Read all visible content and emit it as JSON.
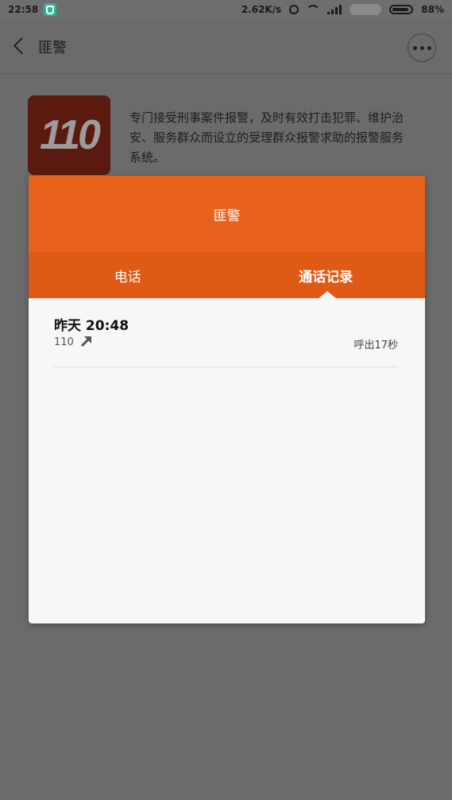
{
  "status_bar": {
    "time": "22:58",
    "network_speed": "2.62K/s",
    "battery": "88%"
  },
  "header": {
    "title": "匪警"
  },
  "info": {
    "logo_text": "110",
    "description": "专门接受刑事案件报警，及时有效打击犯罪、维护治安、服务群众而设立的受理群众报警求助的报警服务系统。"
  },
  "dialog": {
    "title": "匪警",
    "tabs": [
      {
        "label": "电话"
      },
      {
        "label": "通话记录"
      }
    ],
    "active_tab": "通话记录",
    "call_log": [
      {
        "time": "昨天 20:48",
        "number": "110",
        "direction_icon": "outgoing-arrow-icon",
        "duration": "呼出17秒"
      }
    ]
  },
  "colors": {
    "accent": "#e8621c",
    "tab_bar": "#df5a15",
    "overlay": "#6b6b6b"
  }
}
